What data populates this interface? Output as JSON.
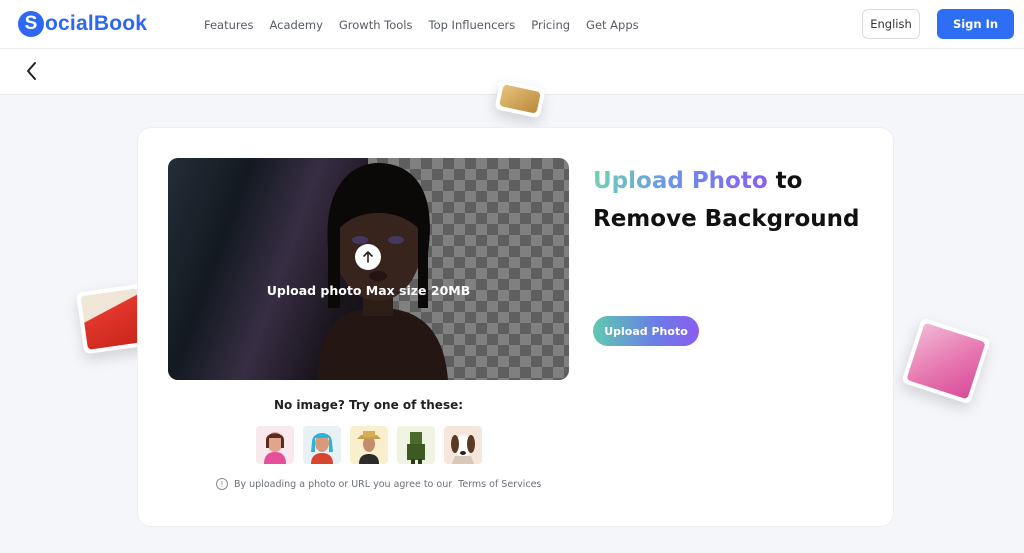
{
  "brand": {
    "logo_letter": "S",
    "logo_text": "ocialBook",
    "color": "#2e67f5"
  },
  "nav": {
    "links": [
      "Features",
      "Academy",
      "Growth Tools",
      "Top Influencers",
      "Pricing",
      "Get Apps"
    ],
    "language": "English",
    "sign_in": "Sign In"
  },
  "subbar": {
    "back_icon": "chevron-left-icon"
  },
  "uploader": {
    "preview_text": "Upload photo Max size 20MB",
    "upload_icon": "arrow-up-icon"
  },
  "hero": {
    "heading_highlight": "Upload Photo",
    "heading_rest_1": " to",
    "heading_line_2": "Remove Background",
    "button_label": "Upload Photo",
    "gradient": [
      "#6fd3b0",
      "#6d8df0",
      "#8a5cf0"
    ]
  },
  "samples": {
    "title": "No image? Try one of these:",
    "items": [
      "sample-woman-pink",
      "sample-woman-blue-hair",
      "sample-woman-hat",
      "sample-green-figure",
      "sample-dog"
    ]
  },
  "terms": {
    "icon": "info-icon",
    "text": "By uploading a photo or URL you agree to our",
    "link": "Terms of Services"
  }
}
